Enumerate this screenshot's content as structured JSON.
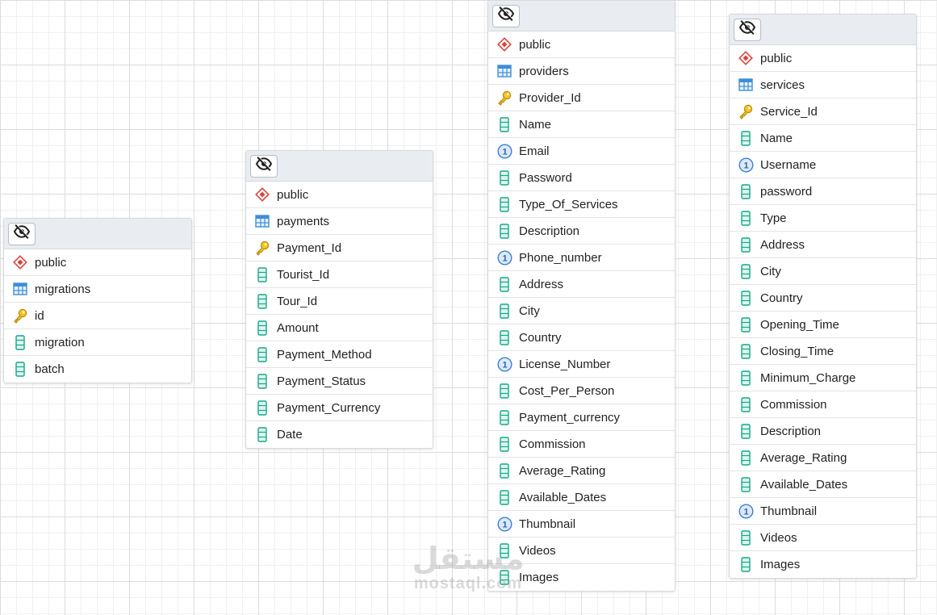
{
  "tables": [
    {
      "schema": "public",
      "name": "migrations",
      "columns": [
        {
          "name": "id",
          "icon": "key-icon"
        },
        {
          "name": "migration",
          "icon": "column-icon"
        },
        {
          "name": "batch",
          "icon": "column-icon"
        }
      ]
    },
    {
      "schema": "public",
      "name": "payments",
      "columns": [
        {
          "name": "Payment_Id",
          "icon": "key-icon"
        },
        {
          "name": "Tourist_Id",
          "icon": "column-icon"
        },
        {
          "name": "Tour_Id",
          "icon": "column-icon"
        },
        {
          "name": "Amount",
          "icon": "column-icon"
        },
        {
          "name": "Payment_Method",
          "icon": "column-icon"
        },
        {
          "name": "Payment_Status",
          "icon": "column-icon"
        },
        {
          "name": "Payment_Currency",
          "icon": "column-icon"
        },
        {
          "name": "Date",
          "icon": "column-icon"
        }
      ]
    },
    {
      "schema": "public",
      "name": "providers",
      "columns": [
        {
          "name": "Provider_Id",
          "icon": "key-icon"
        },
        {
          "name": "Name",
          "icon": "column-icon"
        },
        {
          "name": "Email",
          "icon": "unique-icon"
        },
        {
          "name": "Password",
          "icon": "column-icon"
        },
        {
          "name": "Type_Of_Services",
          "icon": "column-icon"
        },
        {
          "name": "Description",
          "icon": "column-icon"
        },
        {
          "name": "Phone_number",
          "icon": "unique-icon"
        },
        {
          "name": "Address",
          "icon": "column-icon"
        },
        {
          "name": "City",
          "icon": "column-icon"
        },
        {
          "name": "Country",
          "icon": "column-icon"
        },
        {
          "name": "License_Number",
          "icon": "unique-icon"
        },
        {
          "name": "Cost_Per_Person",
          "icon": "column-icon"
        },
        {
          "name": "Payment_currency",
          "icon": "column-icon"
        },
        {
          "name": "Commission",
          "icon": "column-icon"
        },
        {
          "name": "Average_Rating",
          "icon": "column-icon"
        },
        {
          "name": "Available_Dates",
          "icon": "column-icon"
        },
        {
          "name": "Thumbnail",
          "icon": "unique-icon"
        },
        {
          "name": "Videos",
          "icon": "column-icon"
        },
        {
          "name": "Images",
          "icon": "column-icon"
        }
      ]
    },
    {
      "schema": "public",
      "name": "services",
      "columns": [
        {
          "name": "Service_Id",
          "icon": "key-icon"
        },
        {
          "name": "Name",
          "icon": "column-icon"
        },
        {
          "name": "Username",
          "icon": "unique-icon"
        },
        {
          "name": "password",
          "icon": "column-icon"
        },
        {
          "name": "Type",
          "icon": "column-icon"
        },
        {
          "name": "Address",
          "icon": "column-icon"
        },
        {
          "name": "City",
          "icon": "column-icon"
        },
        {
          "name": "Country",
          "icon": "column-icon"
        },
        {
          "name": "Opening_Time",
          "icon": "column-icon"
        },
        {
          "name": "Closing_Time",
          "icon": "column-icon"
        },
        {
          "name": "Minimum_Charge",
          "icon": "column-icon"
        },
        {
          "name": "Commission",
          "icon": "column-icon"
        },
        {
          "name": "Description",
          "icon": "column-icon"
        },
        {
          "name": "Average_Rating",
          "icon": "column-icon"
        },
        {
          "name": "Available_Dates",
          "icon": "column-icon"
        },
        {
          "name": "Thumbnail",
          "icon": "unique-icon"
        },
        {
          "name": "Videos",
          "icon": "column-icon"
        },
        {
          "name": "Images",
          "icon": "column-icon"
        }
      ]
    }
  ],
  "watermark": {
    "arabic": "مستقل",
    "latin": "mostaql.com"
  },
  "colors": {
    "schema": "#d9453d",
    "table": "#3d8ed8",
    "key": "#e8b400",
    "column": "#17a88a",
    "unique": "#3d7ed8",
    "header": "#e9ecf1"
  }
}
